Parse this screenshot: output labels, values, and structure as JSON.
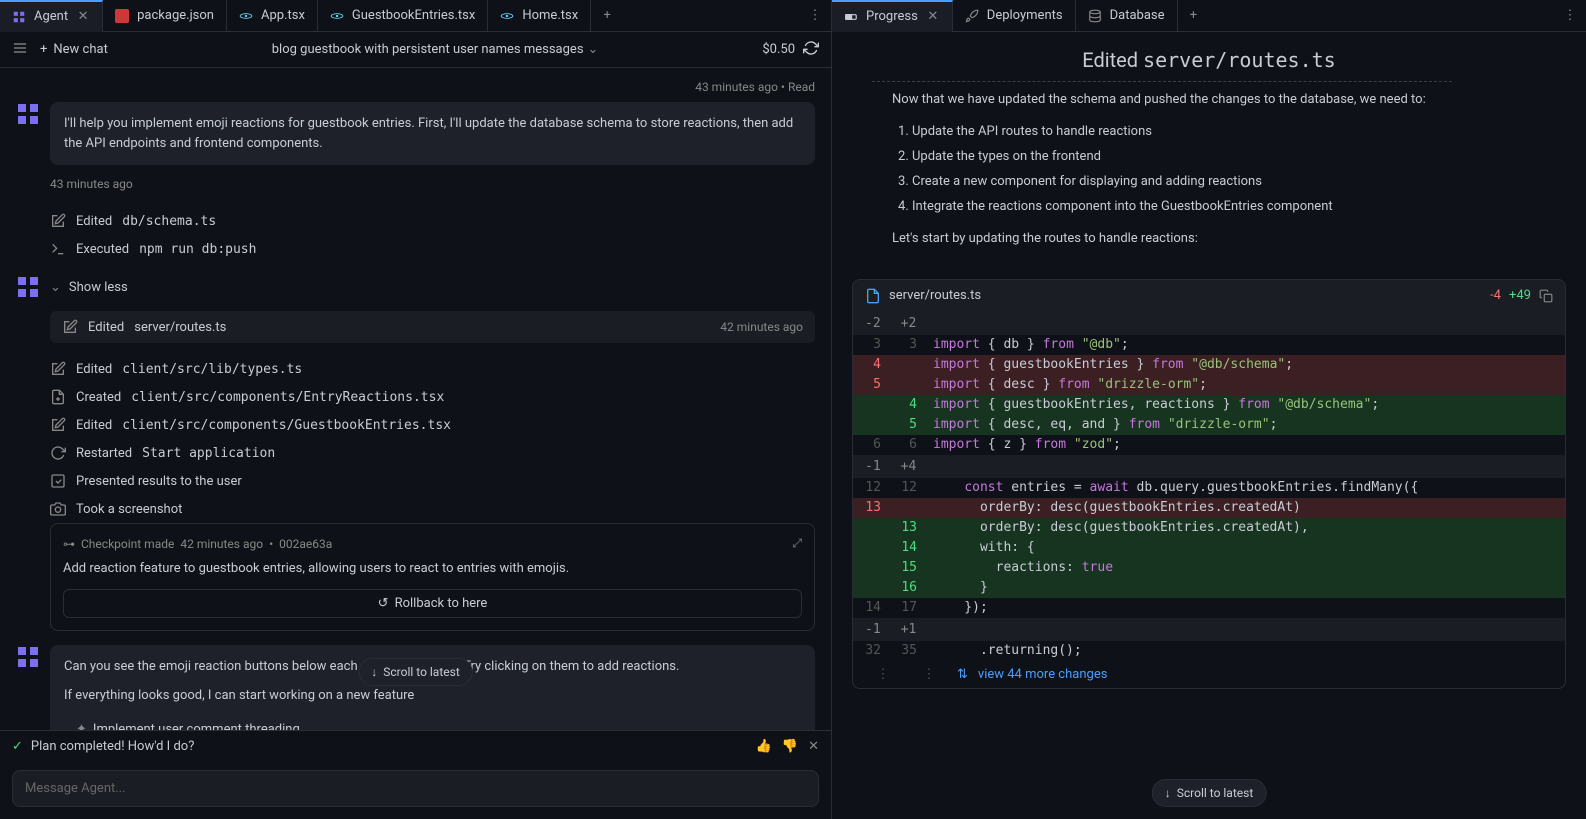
{
  "left": {
    "tabs": [
      {
        "label": "Agent",
        "icon": "agent",
        "active": true,
        "close": true
      },
      {
        "label": "package.json",
        "icon": "npm"
      },
      {
        "label": "App.tsx",
        "icon": "react"
      },
      {
        "label": "GuestbookEntries.tsx",
        "icon": "react"
      },
      {
        "label": "Home.tsx",
        "icon": "react"
      }
    ],
    "toolbar": {
      "new_chat": "New chat",
      "title": "blog guestbook with persistent user names messages",
      "cost": "$0.50"
    },
    "timeline_header": "43 minutes ago  •  Read",
    "msg1": "I'll help you implement emoji reactions for guestbook entries. First, I'll update the database schema to store reactions, then add the API endpoints and frontend components.",
    "msg1_time": "43 minutes ago",
    "actions": {
      "edited_schema": {
        "prefix": "Edited",
        "path": "db/schema.ts"
      },
      "executed": {
        "prefix": "Executed",
        "cmd": "npm run db:push"
      },
      "show_less": "Show less",
      "edited_routes": {
        "prefix": "Edited",
        "path": "server/routes.ts",
        "time": "42 minutes ago"
      },
      "edited_types": {
        "prefix": "Edited",
        "path": "client/src/lib/types.ts"
      },
      "created_reactions": {
        "prefix": "Created",
        "path": "client/src/components/EntryReactions.tsx"
      },
      "edited_entries": {
        "prefix": "Edited",
        "path": "client/src/components/GuestbookEntries.tsx"
      },
      "restarted": {
        "prefix": "Restarted",
        "cmd": "Start application"
      },
      "presented": "Presented results to the user",
      "screenshot": "Took a screenshot"
    },
    "checkpoint": {
      "prefix": "Checkpoint made",
      "time": "42 minutes ago",
      "hash": "002ae63a",
      "text": "Add reaction feature to guestbook entries, allowing users to react to entries with emojis.",
      "rollback": "Rollback to here"
    },
    "msg2_line1": "Can you see the emoji reaction buttons below each guestbook entry? Try clicking on them to add reactions.",
    "msg2_line2": "If everything looks good, I can start working on a new feature",
    "suggestion": "Implement user comment threading",
    "scroll_latest": "Scroll to latest",
    "plan_complete": "Plan completed! How'd I do?",
    "input_placeholder": "Message Agent..."
  },
  "right": {
    "tabs": [
      {
        "label": "Progress",
        "icon": "progress",
        "active": true,
        "close": true
      },
      {
        "label": "Deployments",
        "icon": "rocket"
      },
      {
        "label": "Database",
        "icon": "database"
      }
    ],
    "title_prefix": "Edited",
    "title_path": "server/routes.ts",
    "intro": "Now that we have updated the schema and pushed the changes to the database, we need to:",
    "steps": [
      "Update the API routes to handle reactions",
      "Update the types on the frontend",
      "Create a new component for displaying and adding reactions",
      "Integrate the reactions component into the GuestbookEntries component"
    ],
    "lead": "Let's start by updating the routes to handle reactions:",
    "diff": {
      "file": "server/routes.ts",
      "del": "-4",
      "add": "+49",
      "hunk1": {
        "a": "-2",
        "b": "+2"
      },
      "lines1": [
        {
          "a": "3",
          "b": "3",
          "t": "",
          "code": "import { db } from \"@db\";"
        },
        {
          "a": "4",
          "b": "",
          "t": "d",
          "code": "import { guestbookEntries } from \"@db/schema\";"
        },
        {
          "a": "5",
          "b": "",
          "t": "d",
          "code": "import { desc } from \"drizzle-orm\";"
        },
        {
          "a": "",
          "b": "4",
          "t": "a",
          "code": "import { guestbookEntries, reactions } from \"@db/schema\";"
        },
        {
          "a": "",
          "b": "5",
          "t": "a",
          "code": "import { desc, eq, and } from \"drizzle-orm\";"
        },
        {
          "a": "6",
          "b": "6",
          "t": "",
          "code": "import { z } from \"zod\";"
        }
      ],
      "hunk2": {
        "a": "-1",
        "b": "+4"
      },
      "lines2": [
        {
          "a": "12",
          "b": "12",
          "t": "",
          "code": "    const entries = await db.query.guestbookEntries.findMany({"
        },
        {
          "a": "13",
          "b": "",
          "t": "d",
          "code": "      orderBy: desc(guestbookEntries.createdAt)"
        },
        {
          "a": "",
          "b": "13",
          "t": "a",
          "code": "      orderBy: desc(guestbookEntries.createdAt),"
        },
        {
          "a": "",
          "b": "14",
          "t": "a",
          "code": "      with: {"
        },
        {
          "a": "",
          "b": "15",
          "t": "a",
          "code": "        reactions: true"
        },
        {
          "a": "",
          "b": "16",
          "t": "a",
          "code": "      }"
        },
        {
          "a": "14",
          "b": "17",
          "t": "",
          "code": "    });"
        }
      ],
      "hunk3": {
        "a": "-1",
        "b": "+1"
      },
      "lines3": [
        {
          "a": "32",
          "b": "35",
          "t": "",
          "code": "      .returning();"
        }
      ],
      "view_more": "view 44 more changes"
    },
    "scroll_latest": "Scroll to latest"
  }
}
